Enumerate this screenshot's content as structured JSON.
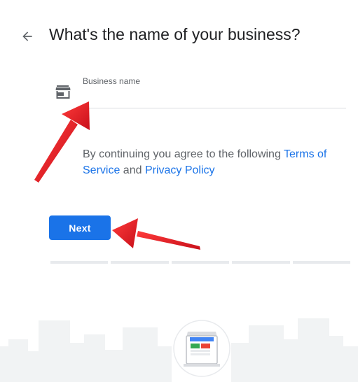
{
  "header": {
    "back_icon": "arrow-back-icon",
    "title": "What's the name of your business?"
  },
  "form": {
    "field_icon": "storefront-icon",
    "field_label": "Business name",
    "field_value": ""
  },
  "terms": {
    "prefix": "By continuing you agree to the following ",
    "tos_link": "Terms of Service",
    "connector": " and ",
    "privacy_link": "Privacy Policy"
  },
  "actions": {
    "next_label": "Next"
  },
  "progress": {
    "total_steps": 5,
    "current_step": 0
  },
  "illustration": {
    "icon": "storefront-illustration-icon"
  },
  "colors": {
    "accent": "#1a73e8",
    "annotation_arrow": "#e31b23"
  }
}
